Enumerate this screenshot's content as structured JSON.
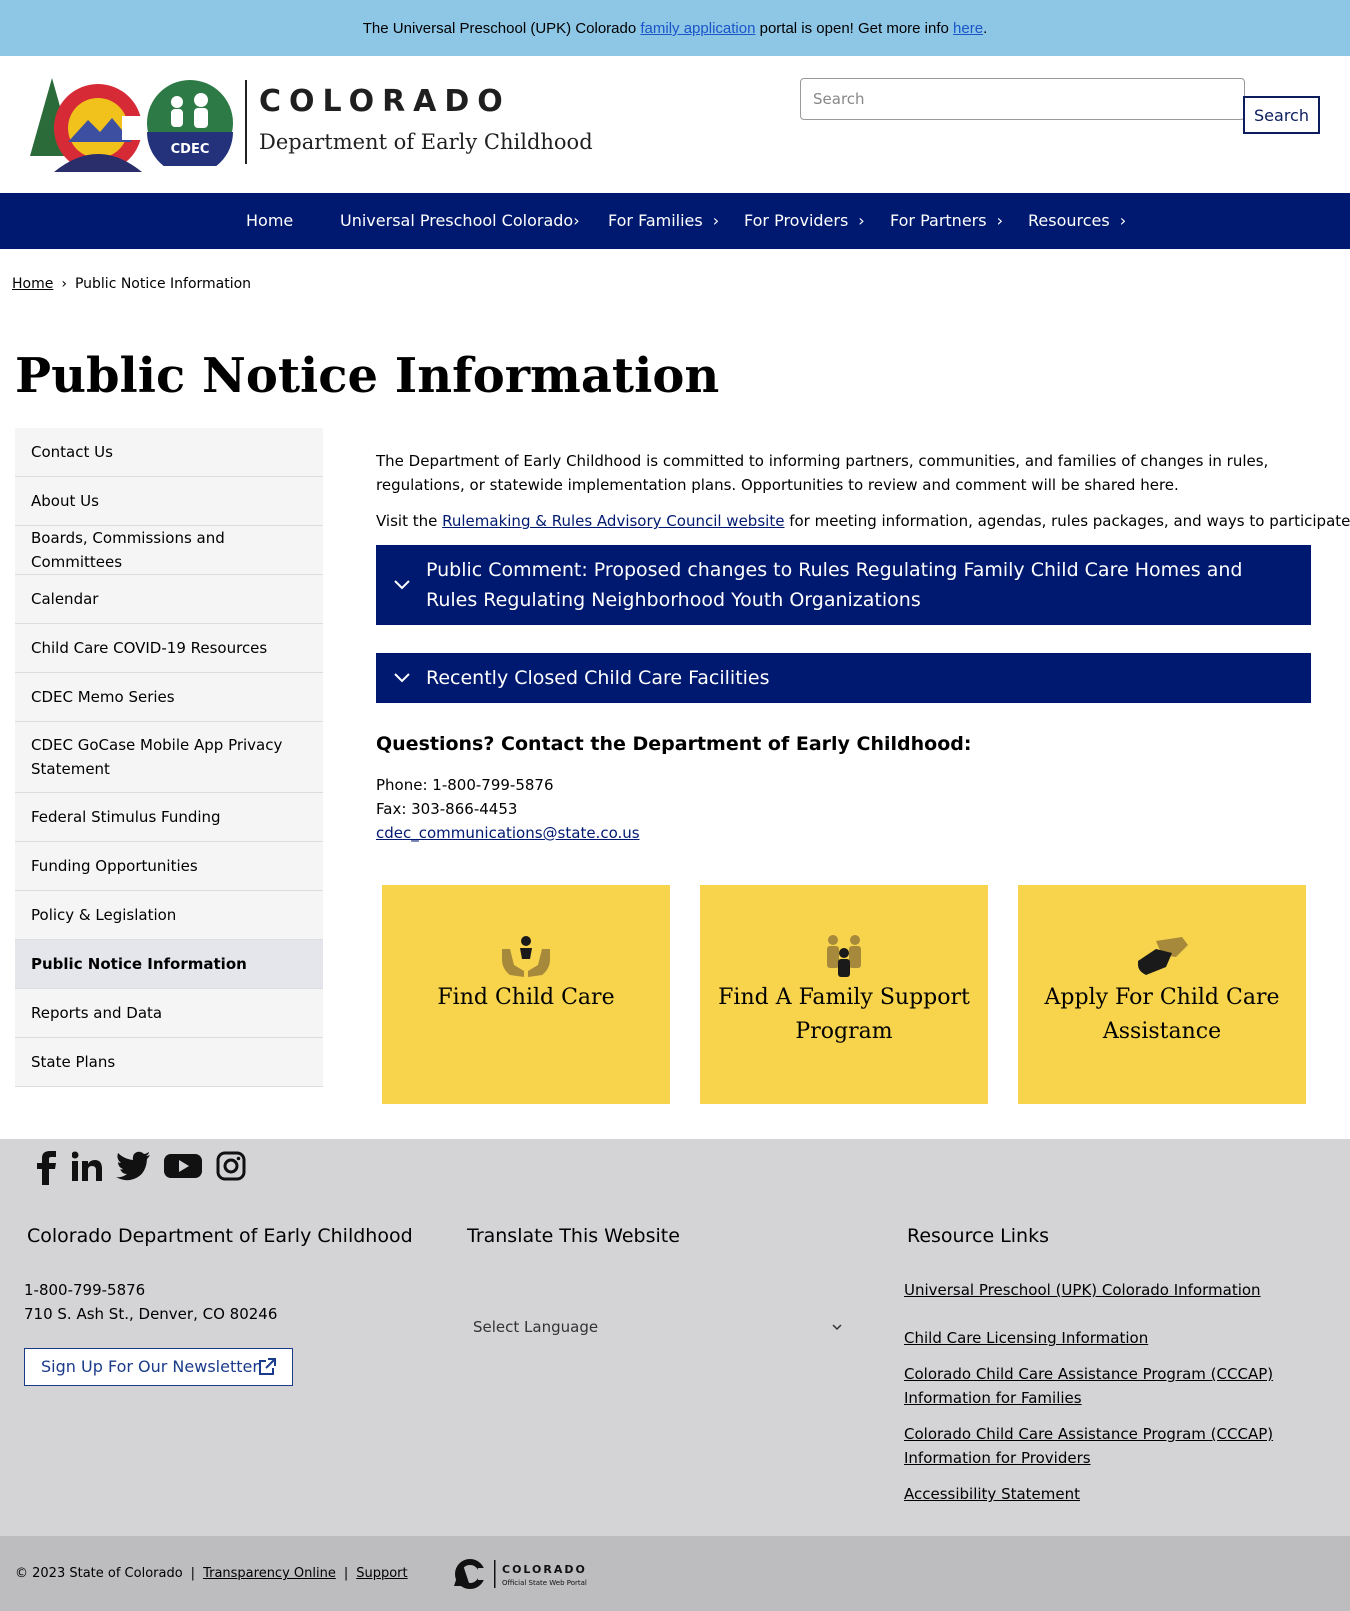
{
  "alert": {
    "prefix": "The Universal Preschool (UPK) Colorado ",
    "link1": "family application",
    "middle": " portal is open! Get more info ",
    "link2": "here",
    "suffix": "."
  },
  "header": {
    "brand_line1": "COLORADO",
    "brand_line2": "Department of Early Childhood",
    "badge_text": "CDEC",
    "search_placeholder": "Search",
    "search_button": "Search"
  },
  "nav": {
    "items": [
      {
        "label": "Home"
      },
      {
        "label": "Universal Preschool Colorado"
      },
      {
        "label": "For Families"
      },
      {
        "label": "For Providers"
      },
      {
        "label": "For Partners"
      },
      {
        "label": "Resources"
      }
    ],
    "chevron": "›"
  },
  "breadcrumb": {
    "home": "Home",
    "separator": "›",
    "current": "Public Notice Information"
  },
  "page_title": "Public Notice Information",
  "sidebar": {
    "items": [
      "Contact Us",
      "About Us",
      "Boards, Commissions and Committees",
      "Calendar",
      "Child Care COVID-19 Resources",
      "CDEC Memo Series",
      "CDEC GoCase Mobile App Privacy Statement",
      "Federal Stimulus Funding",
      "Funding Opportunities",
      "Policy & Legislation",
      "Public Notice Information",
      "Reports and Data",
      "State Plans"
    ]
  },
  "main": {
    "intro": "The Department of Early Childhood is committed to informing partners, communities, and families of changes in rules, regulations, or statewide implementation plans. Opportunities to review and comment will be shared here.",
    "visit_prefix": "Visit the ",
    "visit_link": "Rulemaking & Rules Advisory Council website",
    "visit_suffix": " for meeting information, agendas, rules packages, and ways to participate.",
    "accordion": [
      "Public Comment: Proposed changes to Rules Regulating Family Child Care Homes and Rules Regulating Neighborhood Youth Organizations",
      "Recently Closed Child Care Facilities"
    ],
    "questions_title": "Questions? Contact the Department of Early Childhood:",
    "phone": "Phone: 1-800-799-5876",
    "fax": "Fax: 303-866-4453",
    "email": "cdec_communications@state.co.us"
  },
  "cards": [
    {
      "label": "Find Child Care",
      "icon": "hands-child-icon"
    },
    {
      "label": "Find A Family Support Program",
      "icon": "family-icon"
    },
    {
      "label": "Apply For Child Care Assistance",
      "icon": "handshake-icon"
    }
  ],
  "footer": {
    "col1_title": "Colorado Department of Early Childhood",
    "phone": "1-800-799-5876",
    "address": "710 S. Ash St., Denver, CO 80246",
    "newsletter": "Sign Up For Our Newsletter",
    "col2_title": "Translate This Website",
    "language": "Select Language",
    "col3_title": "Resource Links",
    "links": [
      "Universal Preschool (UPK) Colorado Information",
      "Child Care Licensing Information",
      "Colorado Child Care Assistance Program (CCCAP) Information for Families",
      "Colorado Child Care Assistance Program (CCCAP) Information for Providers",
      "Accessibility Statement"
    ]
  },
  "bottom": {
    "copyright": "© 2023 State of Colorado",
    "link1": "Transparency Online",
    "link2": "Support",
    "portal_name": "COLORADO",
    "portal_sub": "Official State Web Portal"
  },
  "colors": {
    "navy": "#001970",
    "alert_blue": "#8ec6e6",
    "card_yellow": "#f7d44c",
    "footer_gray": "#d4d4d6"
  }
}
